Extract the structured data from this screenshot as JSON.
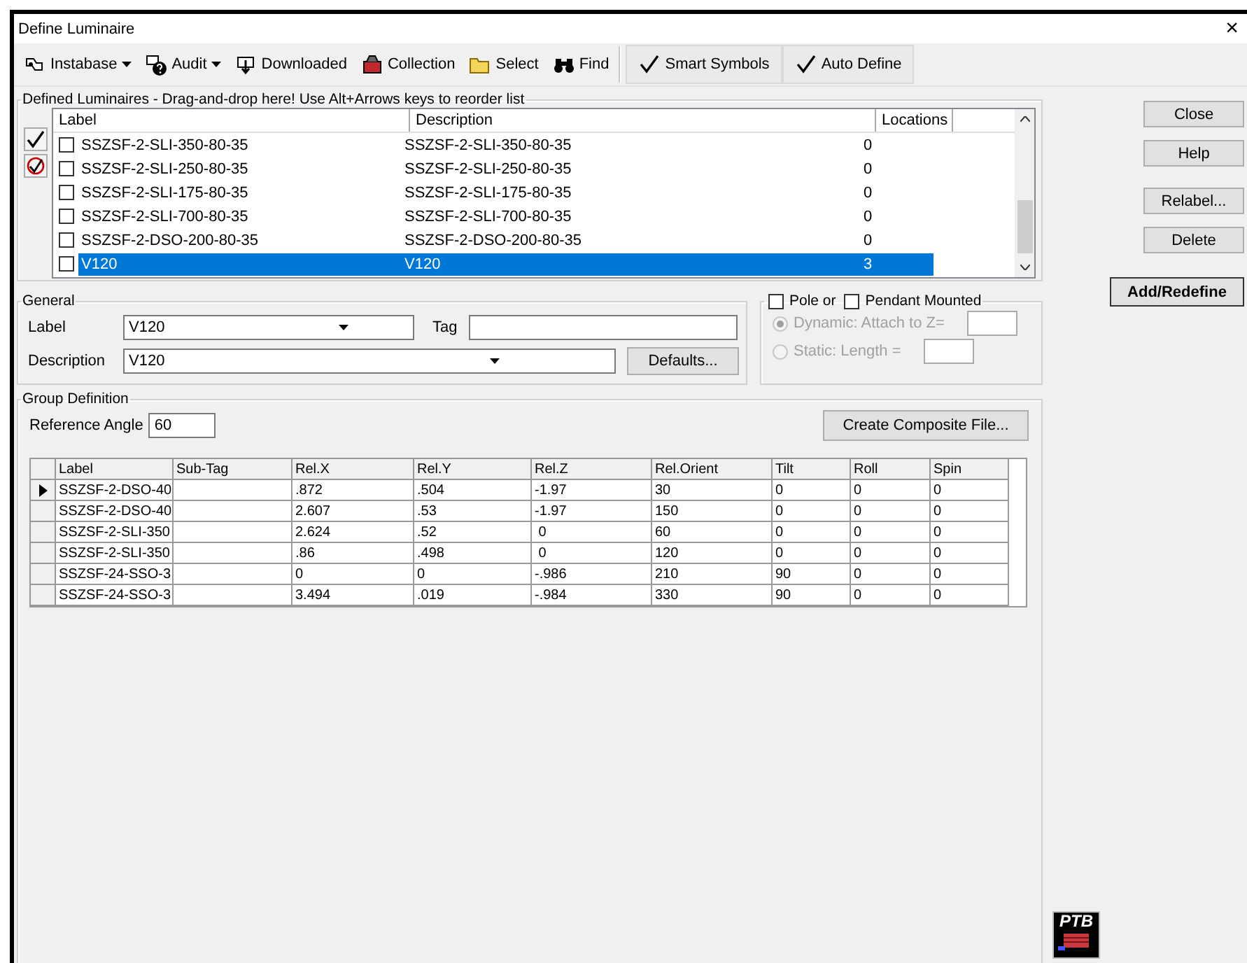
{
  "window": {
    "title": "Define Luminaire",
    "close": "×"
  },
  "toolbar": [
    {
      "label": "Instabase",
      "kind": "dropdown"
    },
    {
      "label": "Audit",
      "kind": "dropdown"
    },
    {
      "label": "Downloaded",
      "kind": "button"
    },
    {
      "label": "Collection",
      "kind": "button"
    },
    {
      "label": "Select",
      "kind": "button"
    },
    {
      "label": "Find",
      "kind": "button"
    },
    {
      "label": "Smart Symbols",
      "kind": "toggle",
      "on": true
    },
    {
      "label": "Auto Define",
      "kind": "toggle",
      "on": true
    }
  ],
  "luminaires": {
    "title": "Defined Luminaires - Drag-and-drop here!  Use Alt+Arrows keys to reorder list",
    "columns": [
      "Label",
      "Description",
      "Locations"
    ],
    "rows": [
      {
        "label": "SSZSF-2-SLI-350-80-35",
        "description": "SSZSF-2-SLI-350-80-35",
        "locations": "0",
        "checked": false,
        "selected": false
      },
      {
        "label": "SSZSF-2-SLI-250-80-35",
        "description": "SSZSF-2-SLI-250-80-35",
        "locations": "0",
        "checked": false,
        "selected": false
      },
      {
        "label": "SSZSF-2-SLI-175-80-35",
        "description": "SSZSF-2-SLI-175-80-35",
        "locations": "0",
        "checked": false,
        "selected": false
      },
      {
        "label": "SSZSF-2-SLI-700-80-35",
        "description": "SSZSF-2-SLI-700-80-35",
        "locations": "0",
        "checked": false,
        "selected": false
      },
      {
        "label": "SSZSF-2-DSO-200-80-35",
        "description": "SSZSF-2-DSO-200-80-35",
        "locations": "0",
        "checked": false,
        "selected": false
      },
      {
        "label": "V120",
        "description": "V120",
        "locations": "3",
        "checked": false,
        "selected": true
      }
    ]
  },
  "general": {
    "title": "General",
    "label_caption": "Label",
    "label_value": "V120",
    "tag_caption": "Tag",
    "description_caption": "Description",
    "description_value": "V120",
    "defaults_button": "Defaults..."
  },
  "mounting": {
    "pole": {
      "label": "Pole or",
      "checked": false
    },
    "pendant": {
      "label": "Pendant Mounted",
      "checked": false
    },
    "options": [
      {
        "label": "Dynamic: Attach to Z=",
        "selected": true,
        "disabled": true
      },
      {
        "label": "Static: Length =",
        "selected": false,
        "disabled": true
      }
    ]
  },
  "group_definition": {
    "title": "Group Definition",
    "reference_angle_caption": "Reference Angle",
    "reference_angle": "60",
    "composite_button": "Create Composite File...",
    "columns": [
      "Label",
      "Sub-Tag",
      "Rel.X",
      "Rel.Y",
      "Rel.Z",
      "Rel.Orient",
      "Tilt",
      "Roll",
      "Spin"
    ],
    "rows": [
      {
        "selected": true,
        "cells": [
          "SSZSF-2-DSO-40",
          "",
          ".872",
          ".504",
          "-1.97",
          "30",
          "0",
          "0",
          "0"
        ]
      },
      {
        "selected": false,
        "cells": [
          "SSZSF-2-DSO-40",
          "",
          "2.607",
          ".53",
          "-1.97",
          "150",
          "0",
          "0",
          "0"
        ]
      },
      {
        "selected": false,
        "cells": [
          "SSZSF-2-SLI-350",
          "",
          "2.624",
          ".52",
          " 0",
          "60",
          "0",
          "0",
          "0"
        ]
      },
      {
        "selected": false,
        "cells": [
          "SSZSF-2-SLI-350",
          "",
          ".86",
          ".498",
          " 0",
          "120",
          "0",
          "0",
          "0"
        ]
      },
      {
        "selected": false,
        "cells": [
          "SSZSF-24-SSO-3",
          "",
          "0",
          "0",
          "-.986",
          "210",
          "90",
          "0",
          "0"
        ]
      },
      {
        "selected": false,
        "cells": [
          "SSZSF-24-SSO-3",
          "",
          "3.494",
          ".019",
          "-.984",
          "330",
          "90",
          "0",
          "0"
        ]
      }
    ]
  },
  "buttons": [
    {
      "label": "Close",
      "default": false
    },
    {
      "label": "Help",
      "default": false
    },
    {
      "label": "Relabel...",
      "default": false
    },
    {
      "label": "Delete",
      "default": false
    },
    {
      "label": "Add/Redefine",
      "default": true
    }
  ],
  "logo": "PTB"
}
